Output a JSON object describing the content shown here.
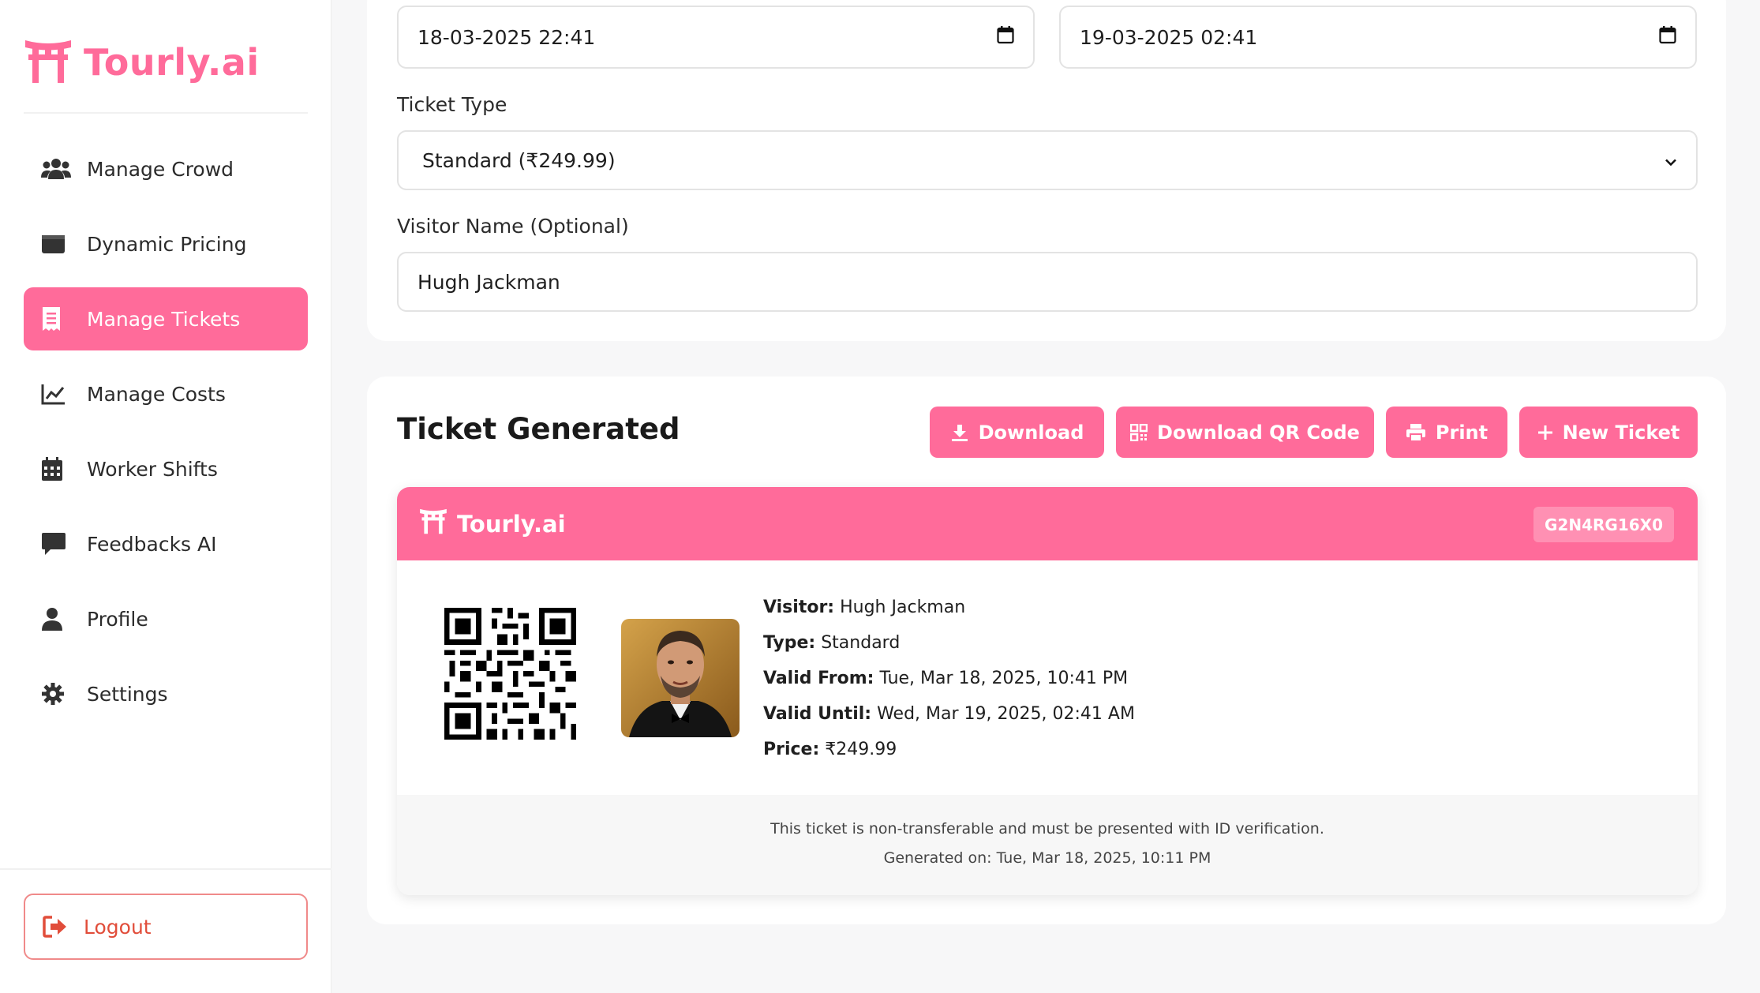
{
  "brand": {
    "name": "Tourly.ai",
    "color": "#ff6b9a"
  },
  "sidebar": {
    "items": [
      {
        "label": "Manage Crowd",
        "icon": "users-icon",
        "active": false
      },
      {
        "label": "Dynamic Pricing",
        "icon": "wallet-icon",
        "active": false
      },
      {
        "label": "Manage Tickets",
        "icon": "receipt-icon",
        "active": true
      },
      {
        "label": "Manage Costs",
        "icon": "line-chart-icon",
        "active": false
      },
      {
        "label": "Worker Shifts",
        "icon": "calendar-icon",
        "active": false
      },
      {
        "label": "Feedbacks AI",
        "icon": "comment-icon",
        "active": false
      },
      {
        "label": "Profile",
        "icon": "user-icon",
        "active": false
      },
      {
        "label": "Settings",
        "icon": "gear-icon",
        "active": false
      }
    ],
    "logout_label": "Logout"
  },
  "form": {
    "valid_from": "18-03-2025  22:41",
    "valid_until": "19-03-2025  02:41",
    "ticket_type_label": "Ticket Type",
    "ticket_type_value": "Standard (₹249.99)",
    "visitor_name_label": "Visitor Name (Optional)",
    "visitor_name_value": "Hugh Jackman"
  },
  "ticket_section": {
    "title": "Ticket Generated",
    "buttons": {
      "download": "Download",
      "download_qr": "Download QR Code",
      "print": "Print",
      "new_ticket": "New Ticket"
    }
  },
  "ticket": {
    "brand": "Tourly.ai",
    "id": "G2N4RG16X0",
    "visitor_label": "Visitor:",
    "visitor": "Hugh Jackman",
    "type_label": "Type:",
    "type": "Standard",
    "valid_from_label": "Valid From:",
    "valid_from": "Tue, Mar 18, 2025, 10:41 PM",
    "valid_until_label": "Valid Until:",
    "valid_until": "Wed, Mar 19, 2025, 02:41 AM",
    "price_label": "Price:",
    "price": "₹249.99",
    "footer_note": "This ticket is non-transferable and must be presented with ID verification.",
    "generated_on": "Generated on: Tue, Mar 18, 2025, 10:11 PM"
  }
}
